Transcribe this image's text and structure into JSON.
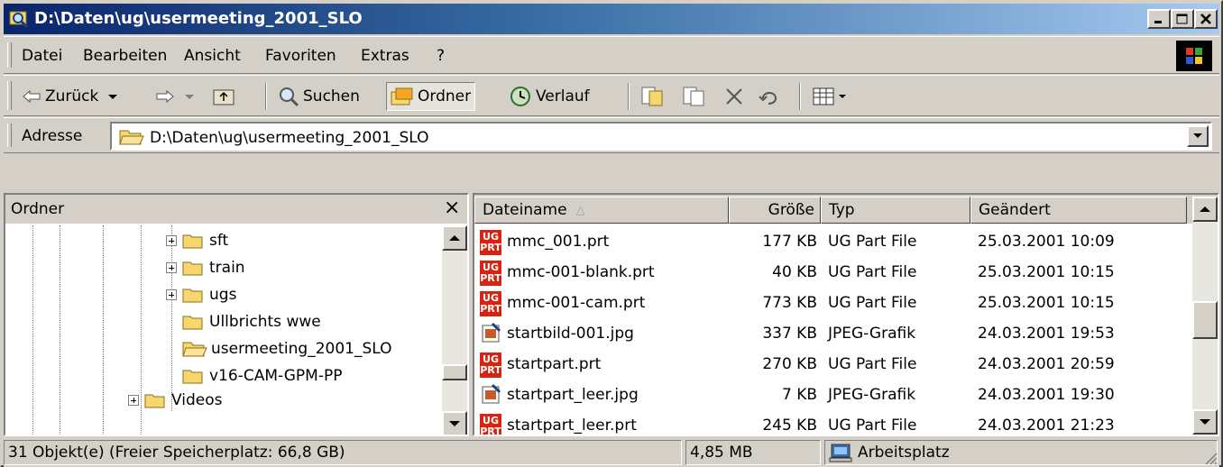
{
  "window": {
    "title": "D:\\Daten\\ug\\usermeeting_2001_SLO",
    "buttons": {
      "minimize": "minimize",
      "maximize": "maximize",
      "close": "close"
    }
  },
  "menu": [
    {
      "label": "Datei"
    },
    {
      "label": "Bearbeiten"
    },
    {
      "label": "Ansicht"
    },
    {
      "label": "Favoriten"
    },
    {
      "label": "Extras"
    },
    {
      "label": "?"
    }
  ],
  "toolbar": {
    "back": "Zurück",
    "search": "Suchen",
    "folders": "Ordner",
    "history": "Verlauf"
  },
  "address": {
    "label": "Adresse",
    "value": "D:\\Daten\\ug\\usermeeting_2001_SLO"
  },
  "folder_pane": {
    "title": "Ordner",
    "close": "×",
    "items": [
      {
        "name": "sft",
        "expandable": true
      },
      {
        "name": "train",
        "expandable": true
      },
      {
        "name": "ugs",
        "expandable": true
      },
      {
        "name": "Ullbrichts wwe",
        "expandable": false
      },
      {
        "name": "usermeeting_2001_SLO",
        "expandable": false,
        "selected": true
      },
      {
        "name": "v16-CAM-GPM-PP",
        "expandable": false
      },
      {
        "name": "Videos",
        "expandable": true
      }
    ]
  },
  "file_list": {
    "columns": [
      "Dateiname",
      "Größe",
      "Typ",
      "Geändert"
    ],
    "sort_indicator": "△",
    "rows": [
      {
        "name": "mmc_001.prt",
        "size": "177 KB",
        "type": "UG Part File",
        "modified": "25.03.2001 10:09",
        "icon": "ug-part-icon"
      },
      {
        "name": "mmc-001-blank.prt",
        "size": "40 KB",
        "type": "UG Part File",
        "modified": "25.03.2001 10:15",
        "icon": "ug-part-icon"
      },
      {
        "name": "mmc-001-cam.prt",
        "size": "773 KB",
        "type": "UG Part File",
        "modified": "25.03.2001 10:15",
        "icon": "ug-part-icon"
      },
      {
        "name": "startbild-001.jpg",
        "size": "337 KB",
        "type": "JPEG-Grafik",
        "modified": "24.03.2001 19:53",
        "icon": "jpeg-icon"
      },
      {
        "name": "startpart.prt",
        "size": "270 KB",
        "type": "UG Part File",
        "modified": "24.03.2001 20:59",
        "icon": "ug-part-icon"
      },
      {
        "name": "startpart_leer.jpg",
        "size": "7 KB",
        "type": "JPEG-Grafik",
        "modified": "24.03.2001 19:30",
        "icon": "jpeg-icon"
      },
      {
        "name": "startpart_leer.prt",
        "size": "245 KB",
        "type": "UG Part File",
        "modified": "24.03.2001 21:23",
        "icon": "ug-part-icon"
      }
    ]
  },
  "status": {
    "objects": "31 Objekt(e) (Freier Speicherplatz: 66,8 GB)",
    "size": "4,85 MB",
    "zone": "Arbeitsplatz"
  },
  "colors": {
    "title_start": "#0a246a",
    "title_end": "#a6caf0",
    "face": "#d4d0c8",
    "ug_red": "#d62410",
    "folder_yellow": "#f5d76e"
  }
}
